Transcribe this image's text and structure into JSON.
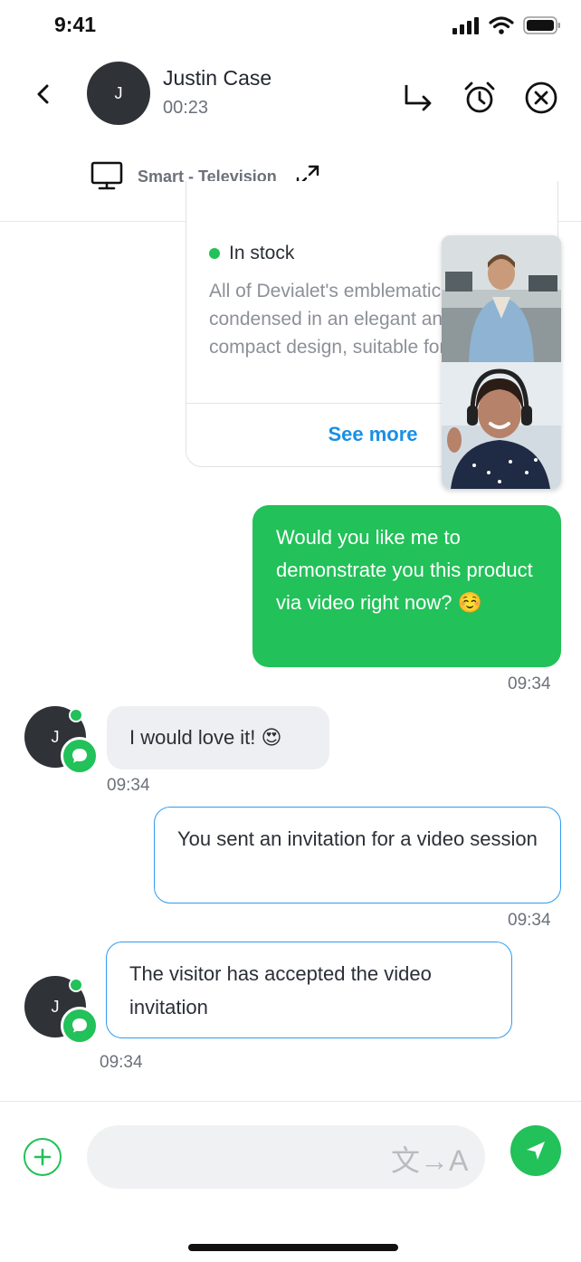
{
  "status_bar": {
    "time": "9:41"
  },
  "header": {
    "contact_name": "Justin Case",
    "avatar_initial": "J",
    "call_timer": "00:23",
    "device_label": "Smart - Television"
  },
  "product_card": {
    "stock_label": "In stock",
    "description": "All of Devialet's emblematic innovations condensed in an elegant and ultra-compact design, suitable for every",
    "see_more": "See more"
  },
  "messages": [
    {
      "text": "Would you like me to demonstrate you this product via video right now? ☺️",
      "time": "09:34"
    },
    {
      "text": "I would love it! 😍",
      "time": "09:34",
      "avatar_initial": "J"
    },
    {
      "text": "You sent an invitation for a video session",
      "time": "09:34"
    },
    {
      "text": "The visitor has accepted the video invitation",
      "time": "09:34",
      "avatar_initial": "J"
    }
  ],
  "composer": {
    "placeholder": "",
    "translate_glyph": "文→A"
  },
  "colors": {
    "accent_green": "#22c159",
    "link_blue": "#1a8fe3",
    "outline_blue": "#2e9cf0",
    "avatar_dark": "#2f3237"
  },
  "icons": [
    "back-chevron-icon",
    "transfer-arrow-icon",
    "alarm-clock-icon",
    "close-circle-icon",
    "television-icon",
    "expand-icon",
    "chat-bubble-icon",
    "plus-icon",
    "translate-icon",
    "send-icon",
    "signal-icon",
    "wifi-icon",
    "battery-icon"
  ]
}
